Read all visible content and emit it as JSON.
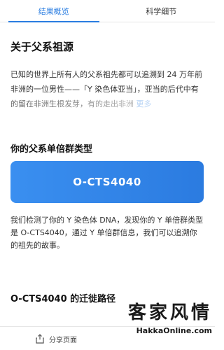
{
  "tabs": [
    {
      "label": "结果概览",
      "active": true
    },
    {
      "label": "科学细节",
      "active": false
    }
  ],
  "about": {
    "title": "关于父系祖源",
    "paragraph": "已知的世界上所有人的父系祖先都可以追溯到 24 万年前非洲的一位男性——「Y 染色体亚当」，亚当的后代中有的留在非洲生根发芽，有的走出非洲",
    "more_label": "更多"
  },
  "haplogroup": {
    "title": "你的父系单倍群类型",
    "value": "O-CTS4040",
    "description": "我们检测了你的 Y 染色体 DNA，发现你的 Y 单倍群类型是 O-CTS4040，通过 Y 单倍群信息，我们可以追溯你的祖先的故事。"
  },
  "migration": {
    "title": "O-CTS4040 的迁徙路径"
  },
  "bottom": {
    "share_label": "分享页面"
  },
  "watermark": {
    "cjk": "客家风情",
    "url": "HakkaOnline.com"
  },
  "colors": {
    "accent": "#2a7de1",
    "card_gradient_start": "#3a8ff0",
    "card_gradient_end": "#2b7be0"
  }
}
